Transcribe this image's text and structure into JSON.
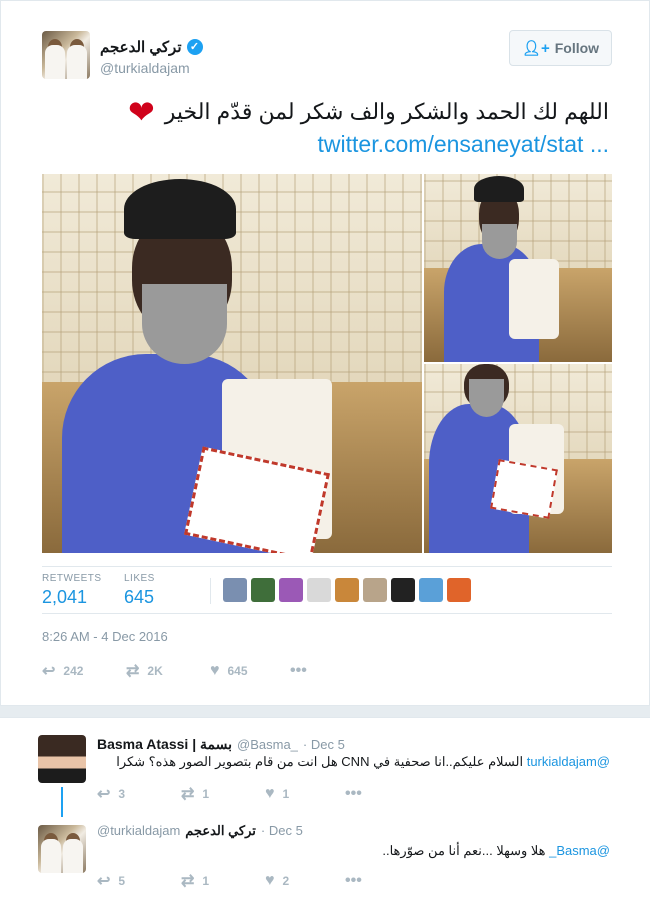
{
  "tweet": {
    "author_name": "تركي الدعجم",
    "author_handle": "@turkialdajam",
    "follow_label": "Follow",
    "text": "اللهم لك الحمد والشكر والف شكر لمن قدّم الخير",
    "link": "twitter.com/ensaneyat/stat ...",
    "stats": {
      "retweets_label": "RETWEETS",
      "retweets_value": "2,041",
      "likes_label": "LIKES",
      "likes_value": "645"
    },
    "timestamp": "8:26 AM - 4 Dec 2016",
    "actions": {
      "reply_count": "242",
      "retweet_count": "2K",
      "like_count": "645"
    }
  },
  "colors": {
    "accent": "#1da1f2",
    "link": "#1b95e0",
    "heart": "#d0021b",
    "muted": "#8899a6"
  },
  "likers": [
    {
      "name": "liker-1",
      "color": "#7a8fb0"
    },
    {
      "name": "liker-2",
      "color": "#3f6e3a"
    },
    {
      "name": "liker-3",
      "color": "#9b59b6"
    },
    {
      "name": "liker-4",
      "color": "#d9d9d9"
    },
    {
      "name": "liker-5",
      "color": "#c9873a"
    },
    {
      "name": "liker-6",
      "color": "#b8a48a"
    },
    {
      "name": "liker-7",
      "color": "#222222"
    },
    {
      "name": "liker-8",
      "color": "#5aa0d8"
    },
    {
      "name": "liker-9",
      "color": "#e0642a"
    }
  ],
  "replies": [
    {
      "name": "Basma Atassi | بسمة",
      "handle": "@Basma_",
      "date": "· Dec 5",
      "mention": "@turkialdajam",
      "text": "السلام عليكم..انا صحفية في CNN هل انت من قام بتصوير الصور هذه؟ شكرا",
      "reply_count": "3",
      "retweet_count": "1",
      "like_count": "1"
    },
    {
      "name": "تركي الدعجم",
      "handle": "@turkialdajam",
      "date": "· Dec 5",
      "mention": "@Basma_",
      "text": "هلا وسهلا ...نعم أنا من صوّرها..",
      "reply_count": "5",
      "retweet_count": "1",
      "like_count": "2"
    }
  ]
}
